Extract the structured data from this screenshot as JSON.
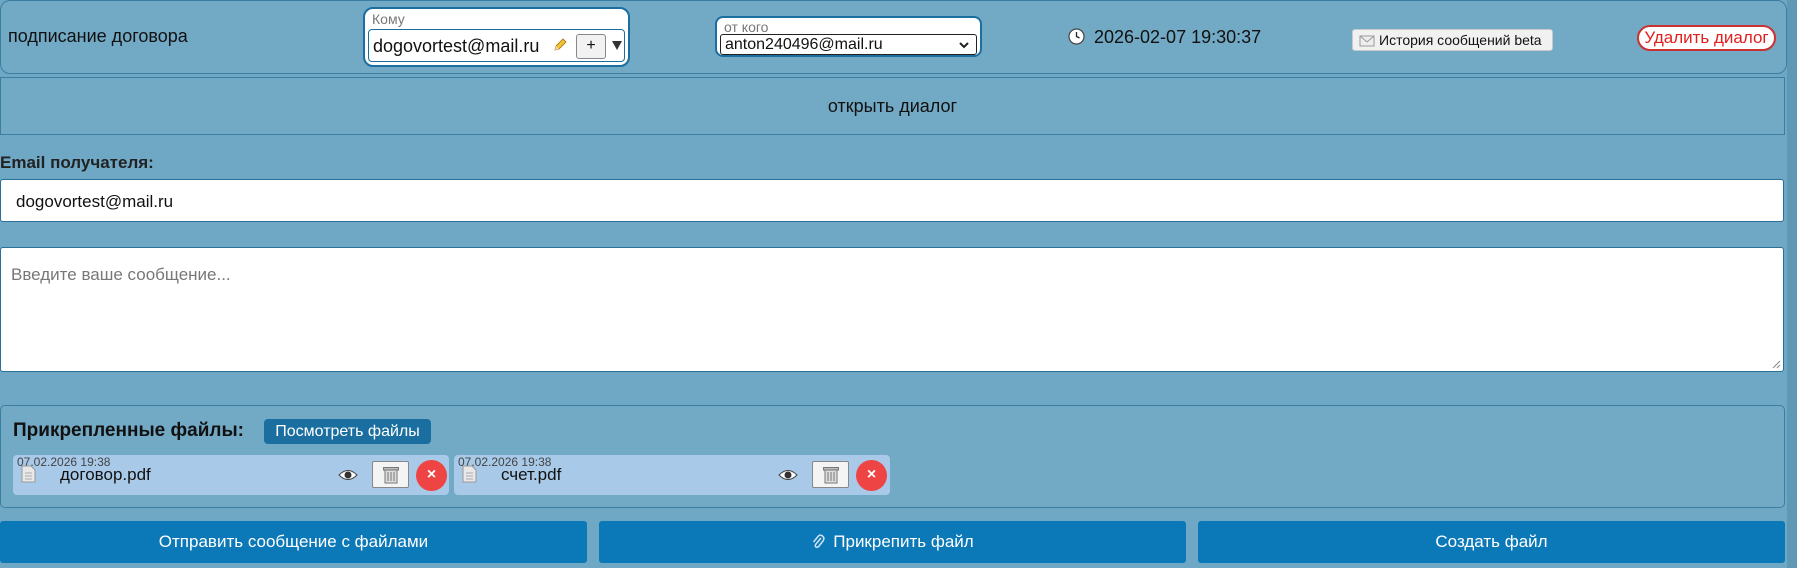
{
  "header": {
    "subject": "подписание договора",
    "to": {
      "caption": "Кому",
      "value": "dogovortest@mail.ru",
      "add_label": "+"
    },
    "from": {
      "caption": "от кого",
      "value": "anton240496@mail.ru"
    },
    "datetime": "2026-02-07 19:30:37",
    "history_label": "История сообщений beta",
    "delete_dialog_label": "Удалить диалог"
  },
  "open_dialog_label": "открыть диалог",
  "recipient": {
    "label": "Email получателя:",
    "value": "dogovortest@mail.ru"
  },
  "message": {
    "placeholder": "Введите ваше сообщение..."
  },
  "attachments": {
    "title": "Прикрепленные файлы:",
    "view_files_label": "Посмотреть файлы",
    "files": [
      {
        "timestamp": "07.02.2026 19:38",
        "name": "договор.pdf",
        "remove_label": "×"
      },
      {
        "timestamp": "07.02.2026 19:38",
        "name": "счет.pdf",
        "remove_label": "×"
      }
    ]
  },
  "actions": {
    "send_label": "Отправить сообщение с файлами",
    "attach_label": "Прикрепить файл",
    "create_label": "Создать файл"
  },
  "colors": {
    "background": "#6fa8c4",
    "primary_button": "#0b78b8",
    "danger": "#e02020"
  }
}
